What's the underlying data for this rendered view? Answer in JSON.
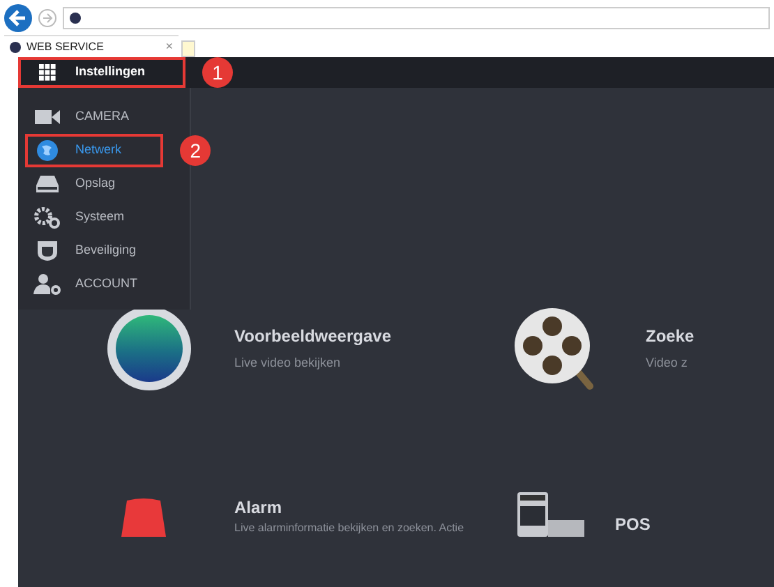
{
  "browser": {
    "tab_title": "WEB SERVICE",
    "tab_close": "×"
  },
  "top_bar": {
    "menu": {
      "label": "Instellingen",
      "highlighted": true,
      "callout": "1"
    }
  },
  "sidebar": {
    "items": [
      {
        "kind": "camera",
        "label": "CAMERA",
        "selected": false,
        "highlighted": false
      },
      {
        "kind": "network",
        "label": "Netwerk",
        "selected": true,
        "highlighted": true,
        "callout": "2"
      },
      {
        "kind": "storage",
        "label": "Opslag",
        "selected": false,
        "highlighted": false
      },
      {
        "kind": "system",
        "label": "Systeem",
        "selected": false,
        "highlighted": false
      },
      {
        "kind": "security",
        "label": "Beveiliging",
        "selected": false,
        "highlighted": false
      },
      {
        "kind": "account",
        "label": "ACCOUNT",
        "selected": false,
        "highlighted": false
      }
    ]
  },
  "tiles": [
    {
      "kind": "live",
      "title": "Voorbeeldweergave",
      "description": "Live video bekijken"
    },
    {
      "kind": "search",
      "title": "Zoeke",
      "description": "Video z"
    },
    {
      "kind": "alarm",
      "title": "Alarm",
      "description": "Live alarminformatie bekijken en zoeken. Actie"
    },
    {
      "kind": "pos",
      "title": "POS"
    }
  ]
}
